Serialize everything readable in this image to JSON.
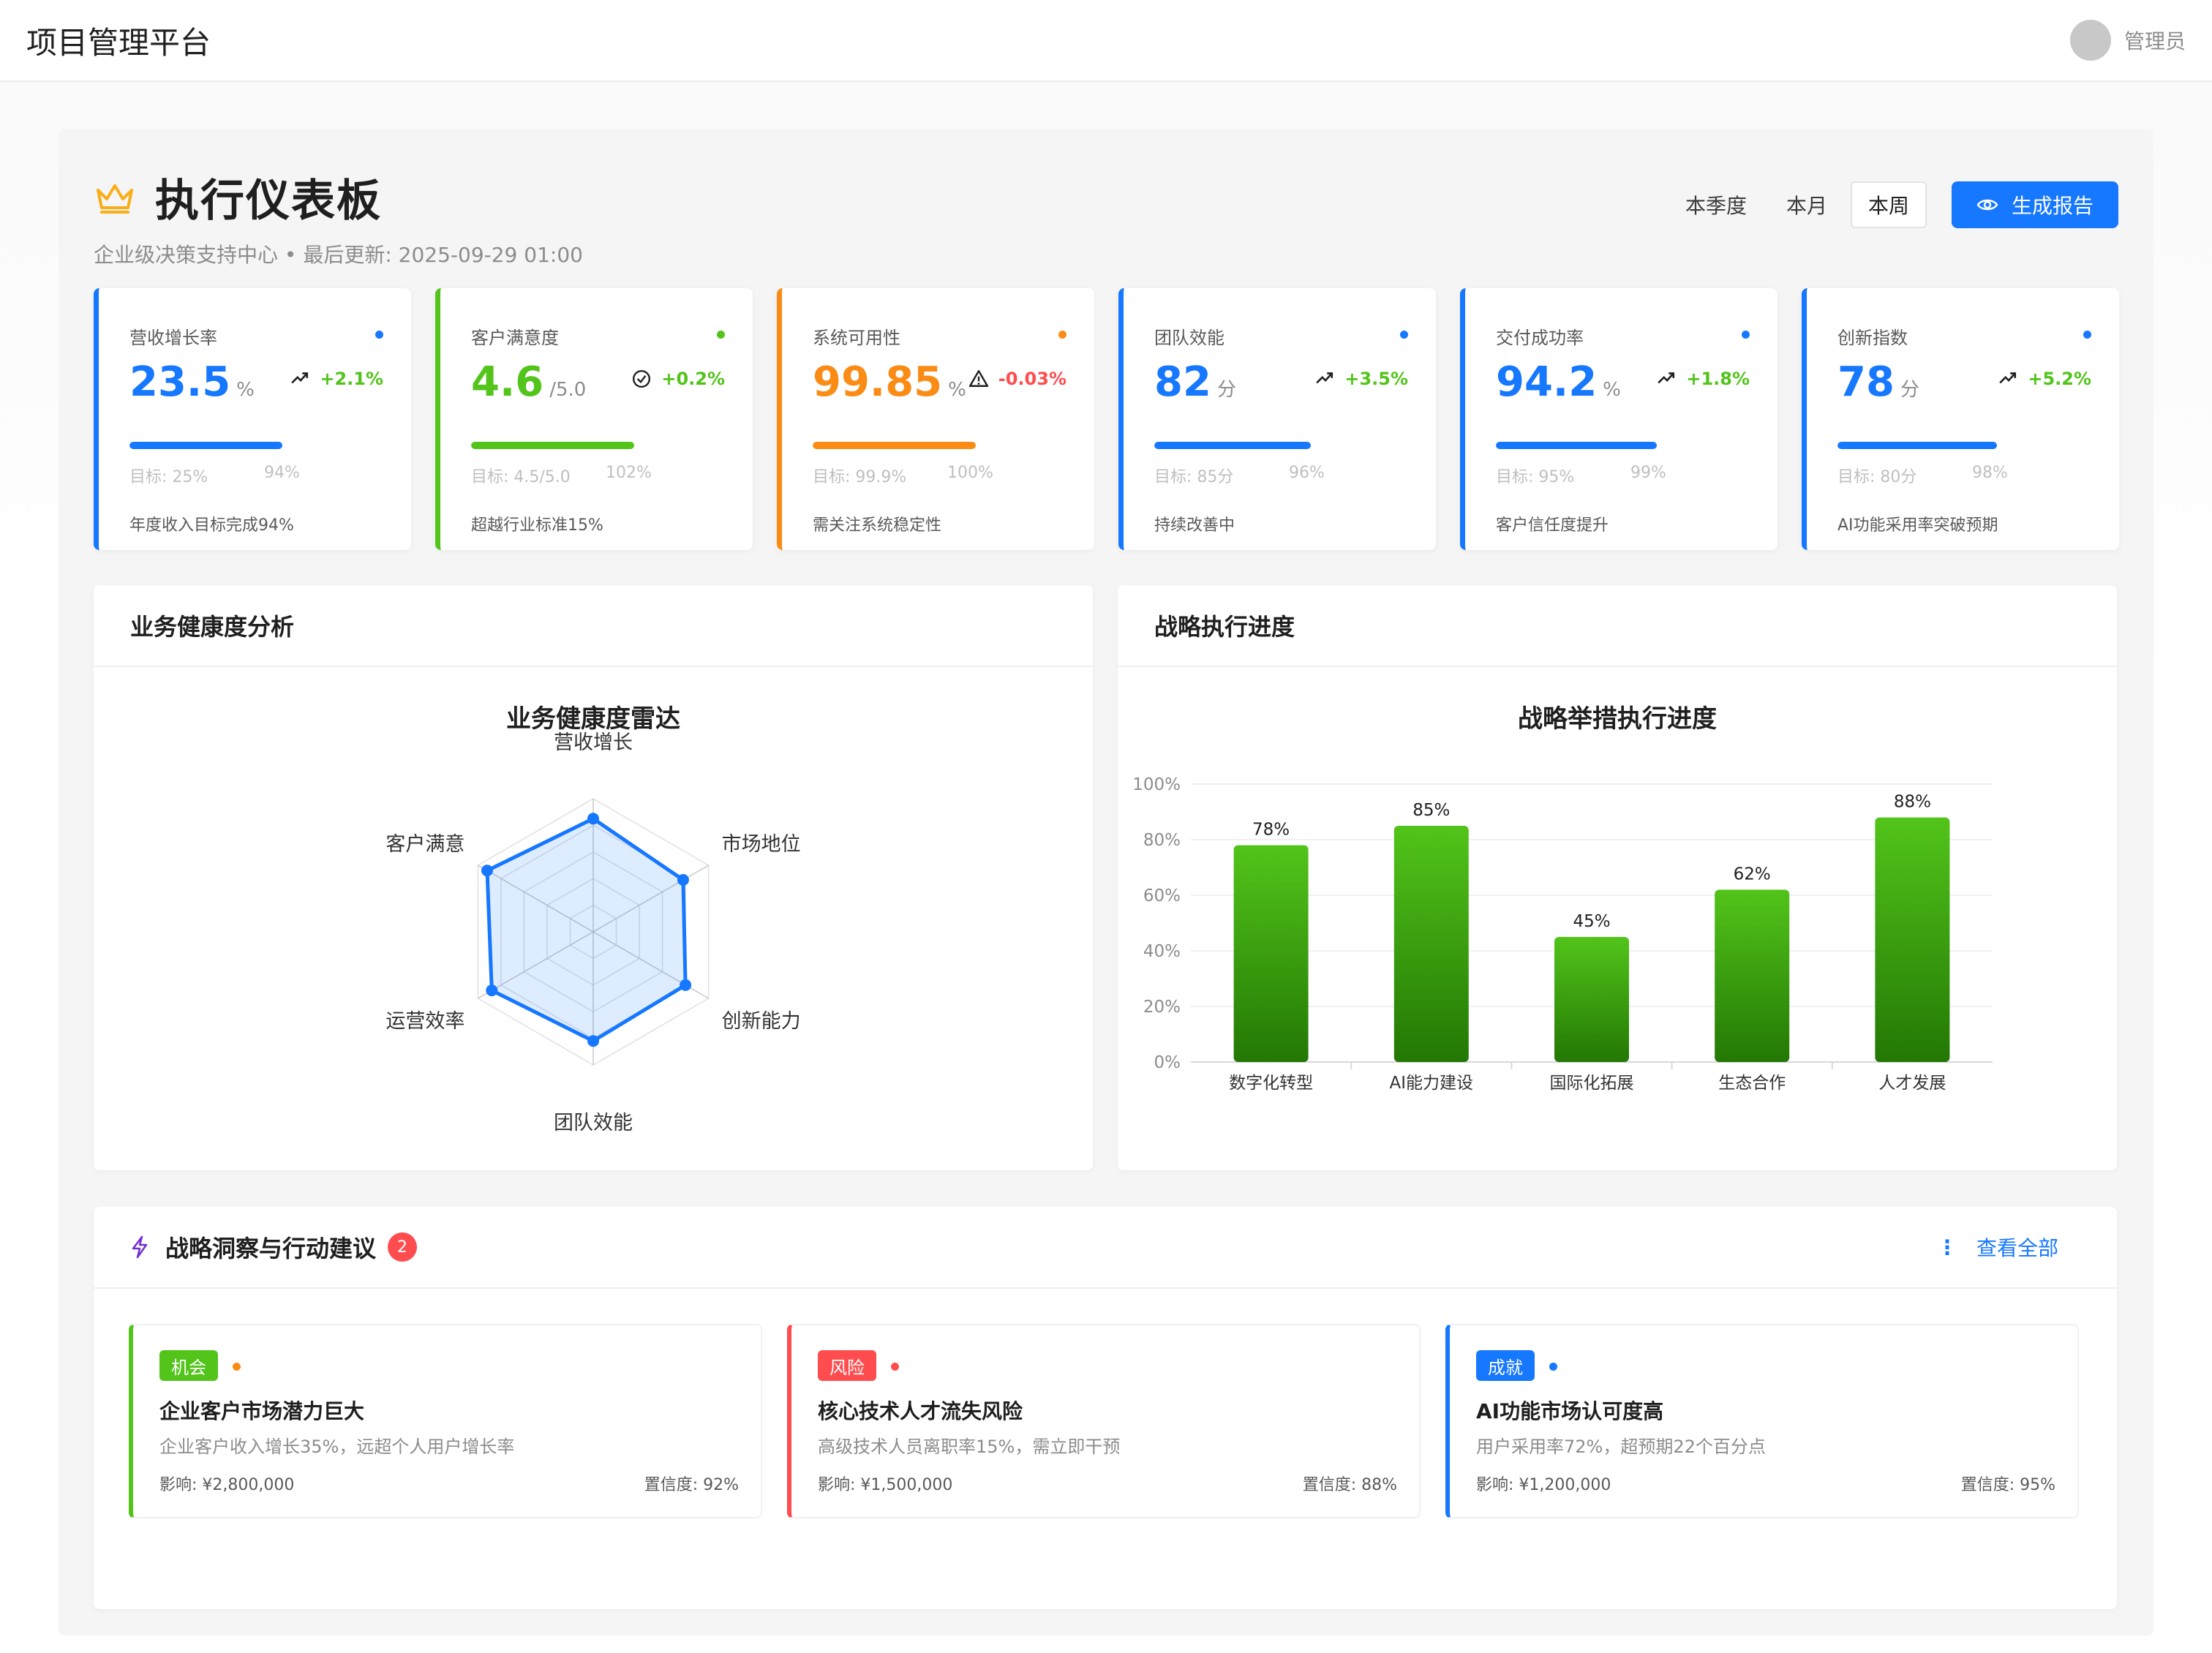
{
  "app": {
    "title": "项目管理平台",
    "user_name": "管理员"
  },
  "header": {
    "title": "执行仪表板",
    "subtitle": "企业级决策支持中心 • 最后更新: 2025-09-29 01:00",
    "periods": [
      "本季度",
      "本月",
      "本周"
    ],
    "active_period": "本周",
    "report_button": "生成报告"
  },
  "kpis": [
    {
      "label": "营收增长率",
      "value": "23.5",
      "unit": "%",
      "trend": "+2.1%",
      "trend_icon": "trend-up-icon",
      "target": "目标: 25%",
      "pct": "94%",
      "progress": 0.94,
      "note": "年度收入目标完成94%",
      "accent": "#1677ff",
      "trend_color": "#52c41a"
    },
    {
      "label": "客户满意度",
      "value": "4.6",
      "unit": "/5.0",
      "trend": "+0.2%",
      "trend_icon": "check-circle-icon",
      "target": "目标: 4.5/5.0",
      "pct": "102%",
      "progress": 1.0,
      "note": "超越行业标准15%",
      "accent": "#52c41a",
      "trend_color": "#52c41a"
    },
    {
      "label": "系统可用性",
      "value": "99.85",
      "unit": "%",
      "trend": "-0.03%",
      "trend_icon": "warning-icon",
      "target": "目标: 99.9%",
      "pct": "100%",
      "progress": 1.0,
      "note": "需关注系统稳定性",
      "accent": "#fa8c16",
      "trend_color": "#ff4d4f"
    },
    {
      "label": "团队效能",
      "value": "82",
      "unit": "分",
      "trend": "+3.5%",
      "trend_icon": "trend-up-icon",
      "target": "目标: 85分",
      "pct": "96%",
      "progress": 0.96,
      "note": "持续改善中",
      "accent": "#1677ff",
      "trend_color": "#52c41a"
    },
    {
      "label": "交付成功率",
      "value": "94.2",
      "unit": "%",
      "trend": "+1.8%",
      "trend_icon": "trend-up-icon",
      "target": "目标: 95%",
      "pct": "99%",
      "progress": 0.99,
      "note": "客户信任度提升",
      "accent": "#1677ff",
      "trend_color": "#52c41a"
    },
    {
      "label": "创新指数",
      "value": "78",
      "unit": "分",
      "trend": "+5.2%",
      "trend_icon": "trend-up-icon",
      "target": "目标: 80分",
      "pct": "98%",
      "progress": 0.98,
      "note": "AI功能采用率突破预期",
      "accent": "#1677ff",
      "trend_color": "#52c41a"
    }
  ],
  "panels": {
    "health": "业务健康度分析",
    "strategy": "战略执行进度"
  },
  "chart_data": [
    {
      "type": "radar",
      "title": "业务健康度雷达",
      "axes": [
        "营收增长",
        "市场地位",
        "创新能力",
        "团队效能",
        "运营效率",
        "客户满意"
      ],
      "values": [
        85,
        78,
        80,
        82,
        88,
        92
      ],
      "max": 100,
      "rings": 5,
      "color": "#1677ff"
    },
    {
      "type": "bar",
      "title": "战略举措执行进度",
      "categories": [
        "数字化转型",
        "AI能力建设",
        "国际化拓展",
        "生态合作",
        "人才发展"
      ],
      "values": [
        78,
        85,
        45,
        62,
        88
      ],
      "data_labels": [
        "78%",
        "85%",
        "45%",
        "62%",
        "88%"
      ],
      "yticks": [
        "0%",
        "20%",
        "40%",
        "60%",
        "80%",
        "100%"
      ],
      "ylim": [
        0,
        100
      ],
      "color": "#52c41a",
      "grid": true
    }
  ],
  "insights": {
    "title": "战略洞察与行动建议",
    "count": "2",
    "view_all": "查看全部",
    "items": [
      {
        "tag": "机会",
        "title": "企业客户市场潜力巨大",
        "desc": "企业客户收入增长35%，远超个人用户增长率",
        "impact": "影响: ¥2,800,000",
        "confidence": "置信度: 92%",
        "tag_color": "#52c41a",
        "dot_color": "#fa8c16"
      },
      {
        "tag": "风险",
        "title": "核心技术人才流失风险",
        "desc": "高级技术人员离职率15%，需立即干预",
        "impact": "影响: ¥1,500,000",
        "confidence": "置信度: 88%",
        "tag_color": "#ff4d4f",
        "dot_color": "#ff4d4f"
      },
      {
        "tag": "成就",
        "title": "AI功能市场认可度高",
        "desc": "用户采用率72%，超预期22个百分点",
        "impact": "影响: ¥1,200,000",
        "confidence": "置信度: 95%",
        "tag_color": "#1677ff",
        "dot_color": "#1677ff"
      }
    ]
  }
}
